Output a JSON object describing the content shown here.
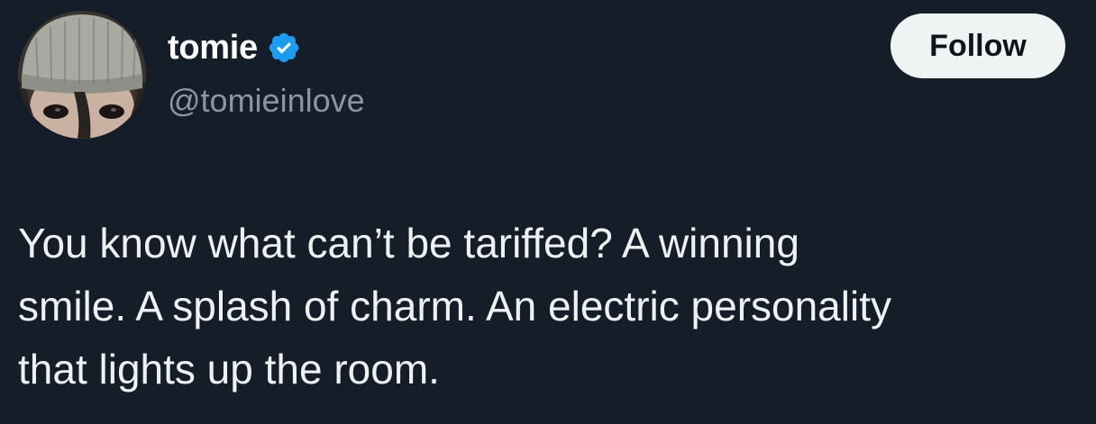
{
  "author": {
    "display_name": "tomie",
    "handle": "@tomieinlove",
    "verified_icon": "verified-badge-icon",
    "avatar_icon": "avatar-photo"
  },
  "actions": {
    "follow_label": "Follow"
  },
  "tweet": {
    "lines": [
      "You know what can’t be tariffed? A winning",
      "smile. A splash of charm. An electric personality",
      "that lights up the room."
    ]
  },
  "colors": {
    "background": "#151d28",
    "text_primary": "#e7e9ea",
    "text_secondary": "#8a96a3",
    "verified_blue": "#1d9bf0",
    "button_bg": "#eff3f4"
  }
}
